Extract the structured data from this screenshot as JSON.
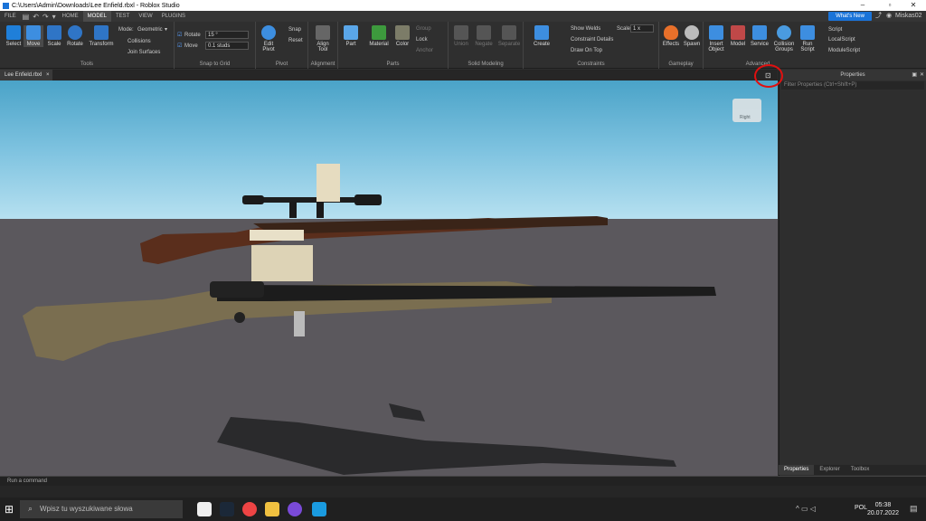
{
  "window": {
    "title": "C:\\Users\\Admin\\Downloads\\Lee Enfield.rbxl - Roblox Studio"
  },
  "menu": {
    "tabs": [
      "FILE",
      "HOME",
      "MODEL",
      "TEST",
      "VIEW",
      "PLUGINS"
    ],
    "active": "MODEL",
    "whats_new": "What's New",
    "user": "Miskas02"
  },
  "ribbon": {
    "tools": {
      "select": "Select",
      "move": "Move",
      "scale": "Scale",
      "rotate": "Rotate",
      "transform": "Transform",
      "label": "Tools"
    },
    "mode": {
      "label": "Mode:",
      "value": "Geometric",
      "collisions": "Collisions",
      "join_surfaces": "Join Surfaces"
    },
    "snap": {
      "rotate": "Rotate",
      "rotate_value": "15 °",
      "move": "Move",
      "move_value": "0.1 studs",
      "label": "Snap to Grid"
    },
    "pivot": {
      "edit_pivot": "Edit Pivot",
      "snap": "Snap",
      "reset": "Reset",
      "label": "Pivot"
    },
    "alignment": {
      "align_tool": "Align Tool",
      "label": "Alignment"
    },
    "parts": {
      "part": "Part",
      "material": "Material",
      "color": "Color",
      "group": "Group",
      "lock": "Lock",
      "anchor": "Anchor",
      "label": "Parts"
    },
    "solid": {
      "union": "Union",
      "negate": "Negate",
      "separate": "Separate",
      "label": "Solid Modeling"
    },
    "constraints": {
      "create": "Create",
      "show_welds": "Show Welds",
      "scale": "Scale",
      "scale_value": "1 x",
      "constraint_details": "Constraint Details",
      "draw_on_top": "Draw On Top",
      "label": "Constraints"
    },
    "gameplay": {
      "effects": "Effects",
      "spawn": "Spawn",
      "label": "Gameplay"
    },
    "advanced": {
      "insert_object": "Insert Object",
      "model": "Model",
      "service": "Service",
      "collision_groups": "Collision Groups",
      "run_script": "Run Script",
      "script": "Script",
      "local_script": "LocalScript",
      "module_script": "ModuleScript",
      "label": "Advanced"
    }
  },
  "doc_tab": {
    "name": "Lee Enfield.rbxl",
    "close": "×"
  },
  "viewcube": {
    "label": "Right"
  },
  "properties": {
    "title": "Properties",
    "filter_placeholder": "Filter Properties (Ctrl+Shift+P)"
  },
  "bottom_tabs": [
    "Properties",
    "Explorer",
    "Toolbox"
  ],
  "command_bar": {
    "placeholder": "Run a command"
  },
  "taskbar": {
    "search": "Wpisz tu wyszukiwane słowa",
    "lang": "POL",
    "time": "05:38",
    "date": "20.07.2022"
  },
  "colors": {
    "accent": "#1a73d8",
    "annotation": "#e01010"
  }
}
